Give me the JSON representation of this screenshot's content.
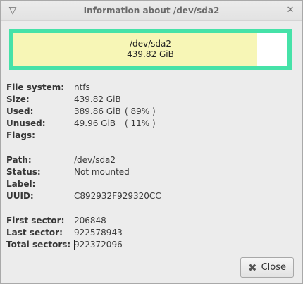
{
  "window": {
    "title": "Information about /dev/sda2"
  },
  "disk_bar": {
    "device": "/dev/sda2",
    "size": "439.82 GiB",
    "used_fraction": 0.89,
    "colors": {
      "frame": "#46e2a8",
      "used": "#f7f6b6",
      "unused": "#ffffff"
    }
  },
  "info": {
    "filesystem": {
      "label": "File system:",
      "value": "ntfs"
    },
    "size": {
      "label": "Size:",
      "value": "439.82 GiB"
    },
    "used": {
      "label": "Used:",
      "value": "389.86 GiB",
      "pct": "( 89% )"
    },
    "unused": {
      "label": "Unused:",
      "value": "49.96 GiB",
      "pct": "( 11% )"
    },
    "flags": {
      "label": "Flags:",
      "value": ""
    },
    "path": {
      "label": "Path:",
      "value": "/dev/sda2"
    },
    "status": {
      "label": "Status:",
      "value": "Not mounted"
    },
    "fs_label": {
      "label": "Label:",
      "value": ""
    },
    "uuid": {
      "label": "UUID:",
      "value": "C892932F929320CC"
    },
    "first_sector": {
      "label": "First sector:",
      "value": "206848"
    },
    "last_sector": {
      "label": "Last sector:",
      "value": "922578943"
    },
    "total_sectors": {
      "label": "Total sectors:",
      "value": "922372096"
    }
  },
  "buttons": {
    "close_label": "Close",
    "close_icon": "x-icon"
  }
}
